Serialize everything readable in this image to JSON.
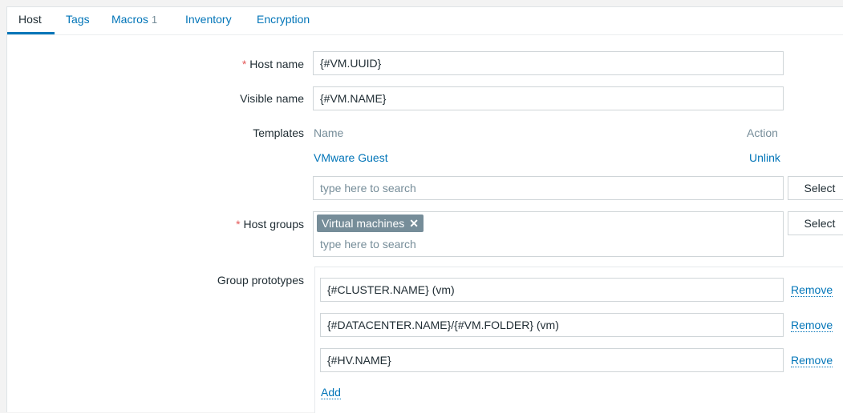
{
  "tabs": [
    {
      "label": "Host"
    },
    {
      "label": "Tags"
    },
    {
      "label": "Macros",
      "count": "1"
    },
    {
      "label": "Inventory"
    },
    {
      "label": "Encryption"
    }
  ],
  "required_mark": "*",
  "host_name": {
    "label": "Host name",
    "value": "{#VM.UUID}"
  },
  "visible_name": {
    "label": "Visible name",
    "value": "{#VM.NAME}"
  },
  "templates": {
    "label": "Templates",
    "col_name": "Name",
    "col_action": "Action",
    "items": [
      {
        "name": "VMware Guest",
        "action": "Unlink"
      }
    ],
    "search_placeholder": "type here to search",
    "select_label": "Select"
  },
  "host_groups": {
    "label": "Host groups",
    "tags": [
      {
        "label": "Virtual machines",
        "remove": "✕"
      }
    ],
    "search_placeholder": "type here to search",
    "select_label": "Select"
  },
  "group_prototypes": {
    "label": "Group prototypes",
    "items": [
      {
        "value": "{#CLUSTER.NAME} (vm)",
        "remove": "Remove"
      },
      {
        "value": "{#DATACENTER.NAME}/{#VM.FOLDER} (vm)",
        "remove": "Remove"
      },
      {
        "value": "{#HV.NAME}",
        "remove": "Remove"
      }
    ],
    "add_label": "Add"
  }
}
